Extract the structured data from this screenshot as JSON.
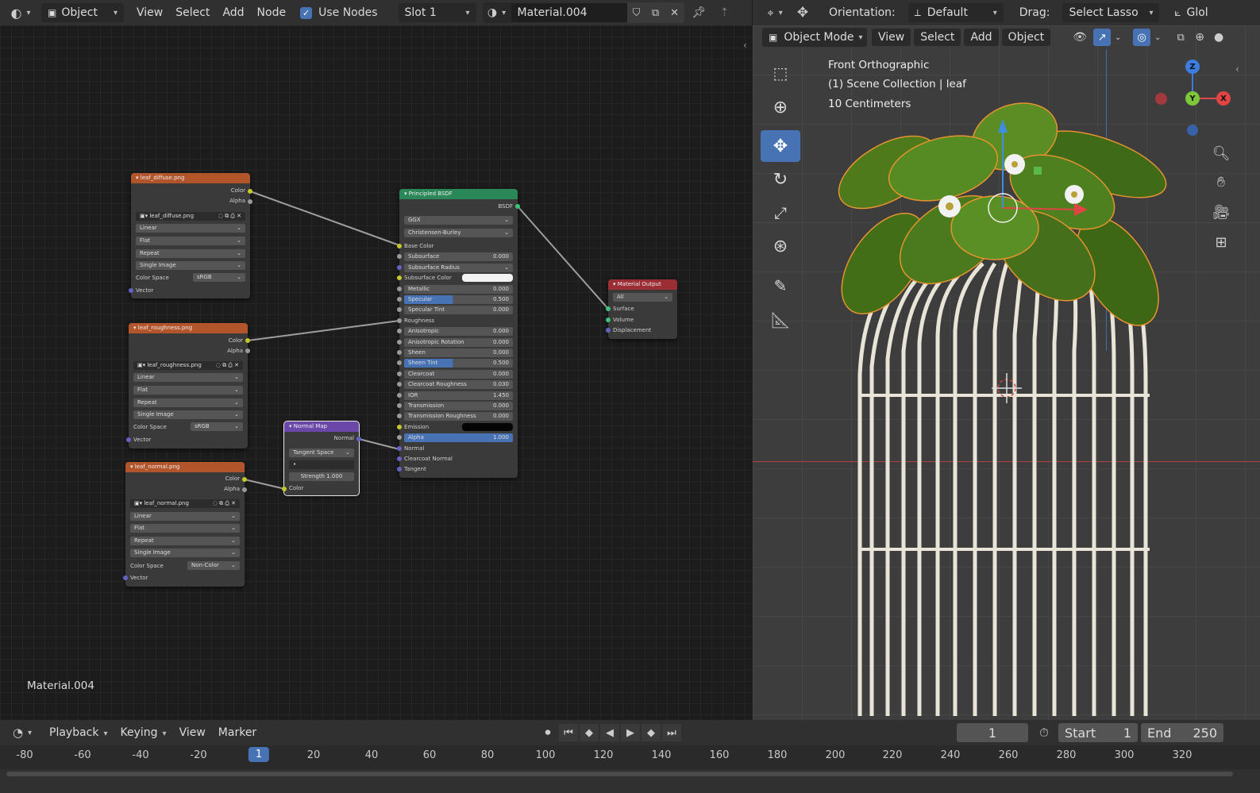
{
  "node_header": {
    "mode": "Object",
    "menus": [
      "View",
      "Select",
      "Add",
      "Node"
    ],
    "use_nodes_label": "Use Nodes",
    "slot": "Slot 1",
    "material_name": "Material.004"
  },
  "viewport_header": {
    "orientation_label": "Orientation:",
    "orientation_value": "Default",
    "drag_label": "Drag:",
    "drag_value": "Select Lasso",
    "global_partial": "Glol",
    "mode": "Object Mode",
    "menus": [
      "View",
      "Select",
      "Add",
      "Object"
    ]
  },
  "viewport_overlay": {
    "view_name": "Front Orthographic",
    "collection": "(1) Scene Collection | leaf",
    "scale": "10 Centimeters"
  },
  "gizmo": {
    "z": "Z",
    "y": "Y",
    "x": "X"
  },
  "node_editor_footer": "Material.004",
  "nodes": {
    "diffuse": {
      "title": "leaf_diffuse.png",
      "out_color": "Color",
      "out_alpha": "Alpha",
      "image": "leaf_diffuse.png",
      "interp": "Linear",
      "proj": "Flat",
      "ext": "Repeat",
      "source": "Single Image",
      "cs_label": "Color Space",
      "cs_value": "sRGB",
      "vector": "Vector"
    },
    "roughness": {
      "title": "leaf_roughness.png",
      "out_color": "Color",
      "out_alpha": "Alpha",
      "image": "leaf_roughness.png",
      "interp": "Linear",
      "proj": "Flat",
      "ext": "Repeat",
      "source": "Single Image",
      "cs_label": "Color Space",
      "cs_value": "sRGB",
      "vector": "Vector"
    },
    "normal": {
      "title": "leaf_normal.png",
      "out_color": "Color",
      "out_alpha": "Alpha",
      "image": "leaf_normal.png",
      "interp": "Linear",
      "proj": "Flat",
      "ext": "Repeat",
      "source": "Single Image",
      "cs_label": "Color Space",
      "cs_value": "Non-Color",
      "vector": "Vector"
    },
    "normal_map": {
      "title": "Normal Map",
      "out": "Normal",
      "space": "Tangent Space",
      "uv": "•",
      "strength_label": "Strength",
      "strength": "1.000",
      "in_color": "Color"
    },
    "bsdf": {
      "title": "Principled BSDF",
      "out": "BSDF",
      "distribution": "GGX",
      "sss_method": "Christensen-Burley",
      "inputs": [
        {
          "label": "Base Color",
          "value": "",
          "kind": "socket"
        },
        {
          "label": "Subsurface",
          "value": "0.000",
          "kind": "field"
        },
        {
          "label": "Subsurface Radius",
          "value": "",
          "kind": "dropdown"
        },
        {
          "label": "Subsurface Color",
          "value": "",
          "kind": "color-white"
        },
        {
          "label": "Metallic",
          "value": "0.000",
          "kind": "field"
        },
        {
          "label": "Specular",
          "value": "0.500",
          "kind": "field-blue"
        },
        {
          "label": "Specular Tint",
          "value": "0.000",
          "kind": "field"
        },
        {
          "label": "Roughness",
          "value": "",
          "kind": "socket"
        },
        {
          "label": "Anisotropic",
          "value": "0.000",
          "kind": "field"
        },
        {
          "label": "Anisotropic Rotation",
          "value": "0.000",
          "kind": "field"
        },
        {
          "label": "Sheen",
          "value": "0.000",
          "kind": "field"
        },
        {
          "label": "Sheen Tint",
          "value": "0.500",
          "kind": "field-blue"
        },
        {
          "label": "Clearcoat",
          "value": "0.000",
          "kind": "field"
        },
        {
          "label": "Clearcoat Roughness",
          "value": "0.030",
          "kind": "field"
        },
        {
          "label": "IOR",
          "value": "1.450",
          "kind": "field"
        },
        {
          "label": "Transmission",
          "value": "0.000",
          "kind": "field"
        },
        {
          "label": "Transmission Roughness",
          "value": "0.000",
          "kind": "field"
        },
        {
          "label": "Emission",
          "value": "",
          "kind": "color-black"
        },
        {
          "label": "Alpha",
          "value": "1.000",
          "kind": "field-full"
        },
        {
          "label": "Normal",
          "value": "",
          "kind": "socket"
        },
        {
          "label": "Clearcoat Normal",
          "value": "",
          "kind": "socket"
        },
        {
          "label": "Tangent",
          "value": "",
          "kind": "socket"
        }
      ]
    },
    "output": {
      "title": "Material Output",
      "target": "All",
      "inputs": [
        "Surface",
        "Volume",
        "Displacement"
      ]
    }
  },
  "timeline": {
    "menus": [
      "Playback",
      "Keying",
      "View",
      "Marker"
    ],
    "current_frame": "1",
    "start_label": "Start",
    "start": "1",
    "end_label": "End",
    "end": "250",
    "ruler": [
      "-80",
      "-60",
      "-40",
      "-20",
      "1",
      "20",
      "40",
      "60",
      "80",
      "100",
      "120",
      "140",
      "160",
      "180",
      "200",
      "220",
      "240",
      "260",
      "280",
      "300",
      "320"
    ]
  }
}
